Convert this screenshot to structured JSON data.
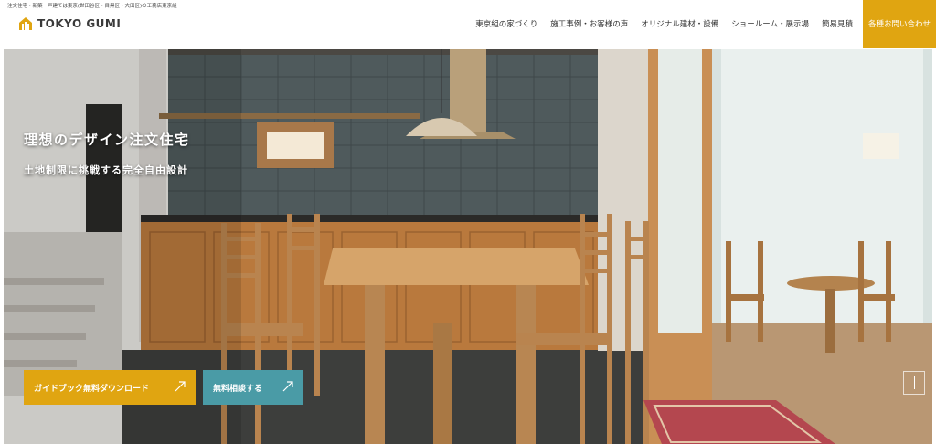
{
  "header": {
    "tagline": "注文住宅・新築一戸建ては東京(世田谷区・目黒区・大田区)の工務店東京組",
    "logo_text": "TOKYO GUMI",
    "nav": [
      {
        "label": "東京組の家づくり"
      },
      {
        "label": "施工事例・お客様の声"
      },
      {
        "label": "オリジナル建材・設備"
      },
      {
        "label": "ショールーム・展示場"
      },
      {
        "label": "簡易見積"
      }
    ],
    "cta_label": "各種お問い合わせ"
  },
  "hero": {
    "title": "理想のデザイン注文住宅",
    "subtitle": "土地制限に挑戦する完全自由設計",
    "guide_button": "ガイドブック無料ダウンロード",
    "consult_button": "無料相談する"
  },
  "colors": {
    "accent": "#e0a511",
    "teal": "#4a9ba6"
  },
  "icons": {
    "logo": "house-logo-icon",
    "arrow": "diagonal-arrow-icon",
    "scroll": "scroll-indicator-icon"
  }
}
